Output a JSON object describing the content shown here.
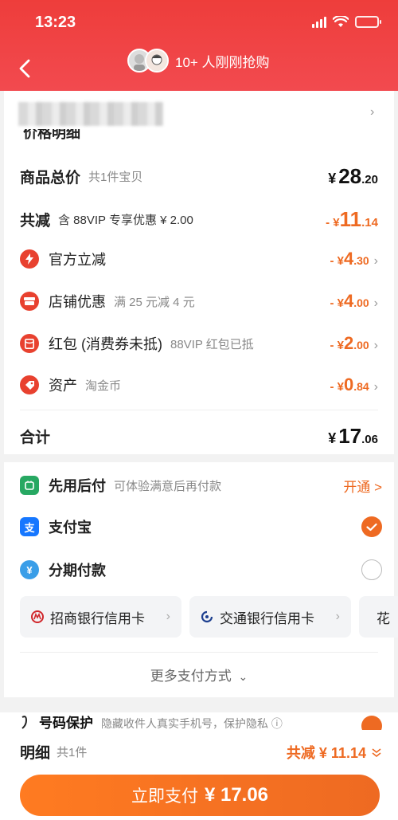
{
  "status_bar": {
    "time": "13:23"
  },
  "header": {
    "group_text": "10+ 人刚刚抢购"
  },
  "price_detail": {
    "title": "价格明细",
    "total": {
      "label": "商品总价",
      "sub": "共1件宝贝",
      "yen": "¥",
      "int": "28",
      "dec": ".20"
    },
    "reduce": {
      "label": "共减",
      "sub": "含 88VIP 专享优惠 ¥ 2.00",
      "prefix": "- ¥",
      "int": "11",
      "dec": ".14"
    },
    "items": [
      {
        "label": "官方立减",
        "sub": "",
        "prefix": "- ¥",
        "int": "4",
        "dec": ".30",
        "icon": "lightning-icon",
        "color": "#e8412f"
      },
      {
        "label": "店铺优惠",
        "sub": "满 25 元减 4 元",
        "prefix": "- ¥",
        "int": "4",
        "dec": ".00",
        "icon": "shop-coupon-icon",
        "color": "#e8412f"
      },
      {
        "label": "红包 (消费券未抵)",
        "sub": "88VIP 红包已抵",
        "prefix": "- ¥",
        "int": "2",
        "dec": ".00",
        "icon": "red-packet-icon",
        "color": "#e8412f"
      },
      {
        "label": "资产",
        "sub": "淘金币",
        "prefix": "- ¥",
        "int": "0",
        "dec": ".84",
        "icon": "tag-icon",
        "color": "#e8412f"
      }
    ],
    "sum": {
      "label": "合计",
      "yen": "¥",
      "int": "17",
      "dec": ".06"
    }
  },
  "payment": {
    "later": {
      "label": "先用后付",
      "sub": "可体验满意后再付款",
      "action": "开通 >"
    },
    "alipay": {
      "label": "支付宝"
    },
    "installment": {
      "label": "分期付款"
    },
    "cards": [
      "招商银行信用卡",
      "交通银行信用卡",
      "花"
    ],
    "more": "更多支付方式"
  },
  "bottom": {
    "protect_title": "号码保护",
    "protect_sub": "隐藏收件人真实手机号，保护隐私 ⓘ",
    "detail_label": "明细",
    "detail_sub": "共1件",
    "reduce_text": "共减 ¥ 11.14",
    "pay_label": "立即支付",
    "pay_amount": "¥ 17.06"
  }
}
